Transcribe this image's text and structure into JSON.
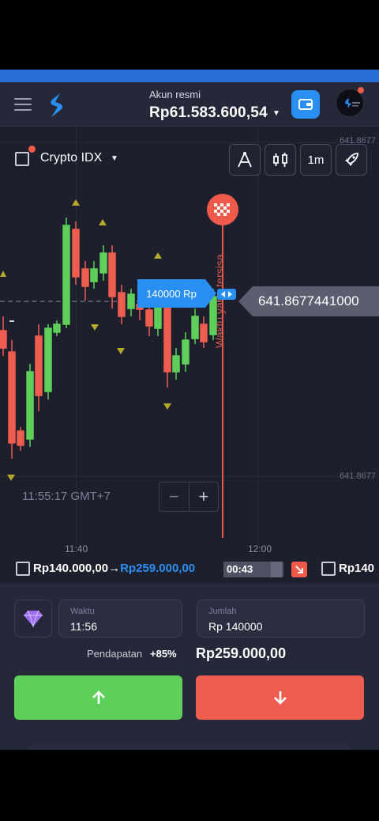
{
  "header": {
    "account_label": "Akun resmi",
    "balance": "Rp61.583.600,54"
  },
  "chart": {
    "asset_name": "Crypto IDX",
    "timeframe": "1m",
    "price_scale_top": "641.8677",
    "price_scale_bottom": "641.8677",
    "current_price": "641.8677441000",
    "investment_tag": "140000 Rp",
    "remaining_time_label": "Waktu yang tersisa",
    "current_time": "11:55:17 GMT+7",
    "x_ticks": [
      "11:40",
      "12:00"
    ],
    "zoom_minus": "−",
    "zoom_plus": "+"
  },
  "deal": {
    "from_amount": "Rp140.000,00",
    "arrow": "→",
    "to_amount": "Rp259.000,00",
    "timer": "00:43",
    "next_deal": "Rp140"
  },
  "trade_panel": {
    "time_label": "Waktu",
    "time_value": "11:56",
    "amount_label": "Jumlah",
    "amount_value": "Rp 140000",
    "payout_label": "Pendapatan",
    "payout_percent": "+85%",
    "payout_amount": "Rp259.000,00"
  },
  "colors": {
    "accent": "#2a8ff2",
    "up": "#5ed05a",
    "down": "#ee5d4f",
    "background": "#1f2230"
  },
  "icons": [
    "menu-icon",
    "logo-icon",
    "wallet-icon",
    "avatar-icon",
    "drawing-tools-icon",
    "indicators-icon",
    "rocket-icon",
    "finish-flag-icon",
    "diamond-icon",
    "arrow-up-icon",
    "arrow-down-icon"
  ]
}
